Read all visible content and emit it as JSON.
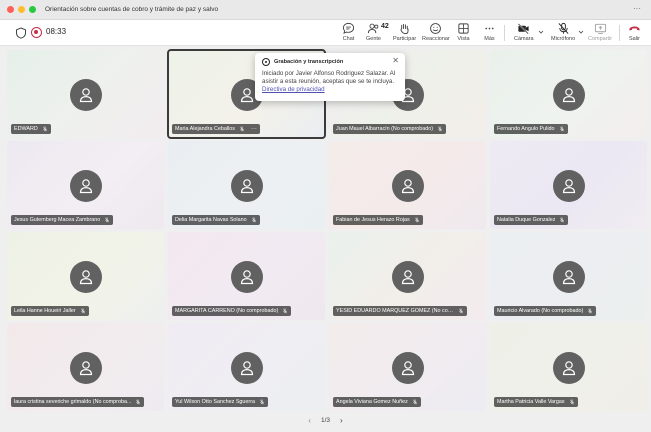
{
  "window": {
    "title": "Orientación sobre cuentas de cobro y trámite de paz y salvo",
    "more": "···"
  },
  "toolbar": {
    "timer": "08:33",
    "participant_count": "42",
    "buttons": [
      {
        "key": "chat",
        "label": "Chat",
        "icon": "chat-icon"
      },
      {
        "key": "people",
        "label": "Gente",
        "icon": "people-icon"
      },
      {
        "key": "raise",
        "label": "Participar",
        "icon": "raise-hand-icon"
      },
      {
        "key": "react",
        "label": "Reaccionar",
        "icon": "smile-icon"
      },
      {
        "key": "view",
        "label": "Vista",
        "icon": "grid-icon"
      },
      {
        "key": "more",
        "label": "Más",
        "icon": "more-icon"
      },
      {
        "key": "camera",
        "label": "Cámara",
        "icon": "camera-off-icon"
      },
      {
        "key": "mic",
        "label": "Micrófono",
        "icon": "mic-off-icon"
      },
      {
        "key": "share",
        "label": "Compartir",
        "icon": "share-icon"
      },
      {
        "key": "leave",
        "label": "Salir",
        "icon": "phone-hangup-icon"
      }
    ]
  },
  "popover": {
    "title": "Grabación y transcripción",
    "body": "Iniciado por Javier Alfonso Rodriguez Salazar. Al asistir a esta reunión, aceptas que se te incluya.",
    "link": "Directiva de privacidad"
  },
  "participants": [
    "EDWARD",
    "Maria Alejandra Ceballos",
    "Juan Mauel Albarracín (No comprobado)",
    "Fernando Angulo Pulido",
    "Jesus Gutemberg Macea Zambrano",
    "Delia Margarita Navas Solano",
    "Fabian de Jesus Herazo Rojas",
    "Natalia Duque Gonzalez",
    "Leila Hanne Houeiri Jaller",
    "MARGARITA CARREÑO (No comprobado)",
    "YESID EDUARDO MARQUEZ GOMEZ (No compr...",
    "Mauricio Alvarado (No comprobado)",
    "laura cristina severiche grimaldo (No comproba...",
    "Yul Wilson Otto Sanchez Sguerra",
    "Angela Viviana Gomez Nuñez",
    "Martha Patricia Valle Vargas"
  ],
  "pager": {
    "label": "1/3",
    "prev": "‹",
    "next": "›"
  },
  "colors": {
    "accent": "#4f52b2",
    "recording": "#c4314b",
    "leave": "#c4314b",
    "avatar": "#616161"
  }
}
